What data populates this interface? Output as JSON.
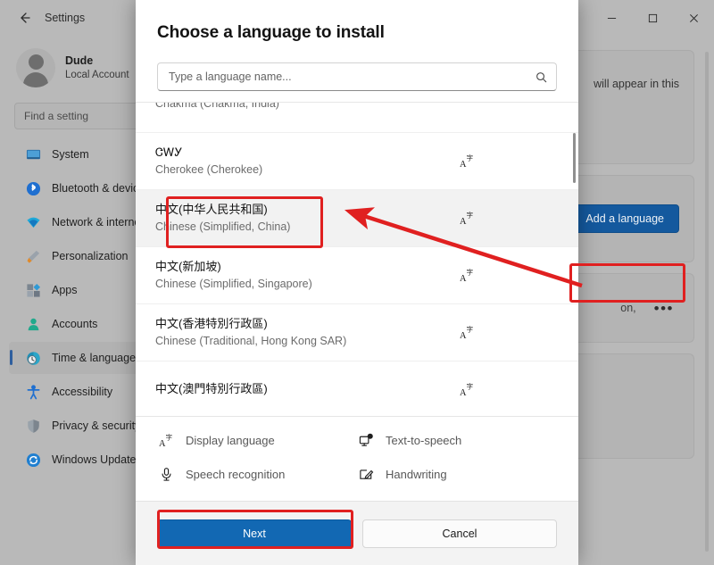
{
  "window": {
    "app_title": "Settings",
    "back_icon": "back-arrow-icon",
    "controls": {
      "minimize": "minimize-icon",
      "maximize": "maximize-icon",
      "close": "close-icon"
    }
  },
  "sidebar": {
    "account": {
      "name": "Dude",
      "type": "Local Account",
      "avatar_icon": "user-avatar-icon"
    },
    "search": {
      "placeholder": "Find a setting",
      "value": ""
    },
    "items": [
      {
        "label": "System",
        "icon": "monitor-icon",
        "selected": false
      },
      {
        "label": "Bluetooth & devices",
        "icon": "bluetooth-icon",
        "selected": false
      },
      {
        "label": "Network & internet",
        "icon": "wifi-icon",
        "selected": false
      },
      {
        "label": "Personalization",
        "icon": "paintbrush-icon",
        "selected": false
      },
      {
        "label": "Apps",
        "icon": "apps-grid-icon",
        "selected": false
      },
      {
        "label": "Accounts",
        "icon": "person-icon",
        "selected": false
      },
      {
        "label": "Time & language",
        "icon": "clock-globe-icon",
        "selected": true
      },
      {
        "label": "Accessibility",
        "icon": "accessibility-icon",
        "selected": false
      },
      {
        "label": "Privacy & security",
        "icon": "shield-icon",
        "selected": false
      },
      {
        "label": "Windows Update",
        "icon": "update-sync-icon",
        "selected": false
      }
    ]
  },
  "main": {
    "windows_display_text": "will appear in this",
    "add_language_button": "Add a language",
    "language_entry_text": "on,",
    "more_options_icon": "ellipsis-icon",
    "region_dropdown_icon": "chevron-down-icon"
  },
  "dialog": {
    "title": "Choose a language to install",
    "search": {
      "placeholder": "Type a language name...",
      "value": "",
      "icon": "search-icon"
    },
    "languages": [
      {
        "native": "",
        "english": "Chakma (Chakma, India)",
        "feature_icon": "display-language-icon",
        "highlighted": false,
        "partial": true
      },
      {
        "native": "ᏣᎳᎩ",
        "english": "Cherokee (Cherokee)",
        "feature_icon": "display-language-icon",
        "highlighted": false,
        "partial": false
      },
      {
        "native": "中文(中华人民共和国)",
        "english": "Chinese (Simplified, China)",
        "feature_icon": "display-language-icon",
        "highlighted": true,
        "partial": false
      },
      {
        "native": "中文(新加坡)",
        "english": "Chinese (Simplified, Singapore)",
        "feature_icon": "display-language-icon",
        "highlighted": false,
        "partial": false
      },
      {
        "native": "中文(香港特別行政區)",
        "english": "Chinese (Traditional, Hong Kong SAR)",
        "feature_icon": "display-language-icon",
        "highlighted": false,
        "partial": false
      },
      {
        "native": "中文(澳門特別行政區)",
        "english": "",
        "feature_icon": "display-language-icon",
        "highlighted": false,
        "partial": true
      }
    ],
    "features": [
      {
        "label": "Display language",
        "icon": "display-language-icon"
      },
      {
        "label": "Text-to-speech",
        "icon": "text-to-speech-icon"
      },
      {
        "label": "Speech recognition",
        "icon": "microphone-icon"
      },
      {
        "label": "Handwriting",
        "icon": "handwriting-pen-icon"
      }
    ],
    "buttons": {
      "next": "Next",
      "cancel": "Cancel"
    }
  },
  "colors": {
    "accent_blue": "#1268b3",
    "add_language_blue": "#14599e",
    "annotation_red": "#e02020",
    "selected_indicator": "#2f5f9e"
  }
}
